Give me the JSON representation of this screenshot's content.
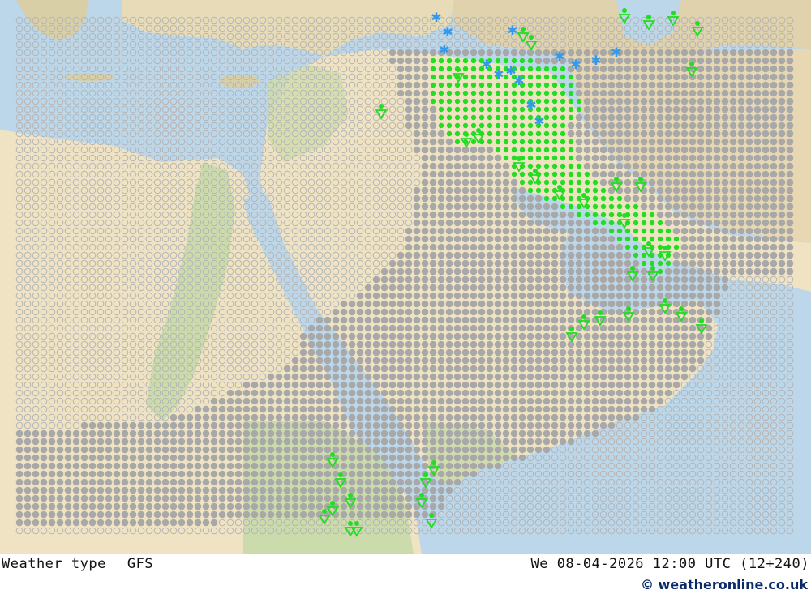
{
  "footer": {
    "product": "Weather type",
    "model": "GFS",
    "valid_time": "We 08-04-2026 12:00 UTC (12+240)",
    "credit": "© weatheronline.co.uk"
  },
  "colors": {
    "sea": "#bcd7ea",
    "land_desert": "#efe3c3",
    "land_green": "#c3d8a6",
    "land_highland": "#dcc9a0",
    "cloud_symbol": "#a8a8a8",
    "clear_symbol": "#b4b4b4",
    "rain": "#22dd22",
    "snow": "#3399ee"
  },
  "legend_symbols": [
    "clear-open-circle",
    "half-cloud-circle",
    "overcast-filled-circle",
    "rain-dot",
    "shower-triangle",
    "snow-asterisk"
  ]
}
